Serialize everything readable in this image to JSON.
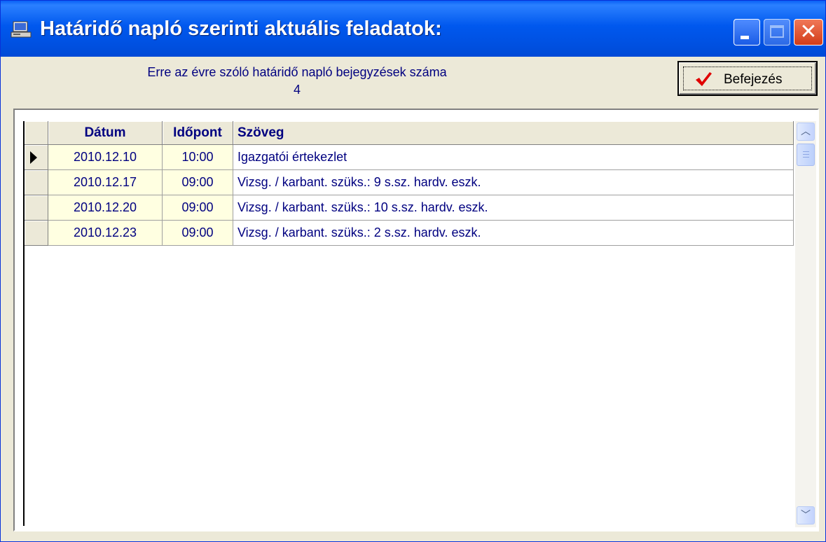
{
  "window": {
    "title": "Határidő napló szerinti aktuális feladatok:",
    "icons": {
      "app": "computer-icon",
      "minimize": "minimize-icon",
      "maximize": "maximize-icon",
      "close": "close-icon"
    },
    "close_glyph": "✕"
  },
  "summary": {
    "label": "Erre az évre szóló határidő napló bejegyzések száma",
    "count": "4"
  },
  "finish_button": {
    "label": "Befejezés",
    "icon": "checkmark-icon"
  },
  "grid": {
    "columns": [
      "Dátum",
      "Időpont",
      "Szöveg"
    ],
    "rows": [
      {
        "date": "2010.12.10",
        "time": "10:00",
        "text": "Igazgatói értekezlet",
        "current": true
      },
      {
        "date": "2010.12.17",
        "time": "09:00",
        "text": "Vizsg. / karbant. szüks.: 9 s.sz. hardv. eszk.",
        "current": false
      },
      {
        "date": "2010.12.20",
        "time": "09:00",
        "text": "Vizsg. / karbant. szüks.: 10 s.sz. hardv. eszk.",
        "current": false
      },
      {
        "date": "2010.12.23",
        "time": "09:00",
        "text": "Vizsg. / karbant. szüks.: 2 s.sz. hardv. eszk.",
        "current": false
      }
    ]
  },
  "scrollbar": {
    "up_glyph": "︿",
    "down_glyph": "﹀",
    "icons": {
      "up": "chevron-up-icon",
      "down": "chevron-down-icon"
    }
  },
  "colors": {
    "titlebar": "#0054e3",
    "grid_text": "#000080",
    "date_cell_bg": "#ffffe1",
    "close_button": "#d23c19"
  }
}
